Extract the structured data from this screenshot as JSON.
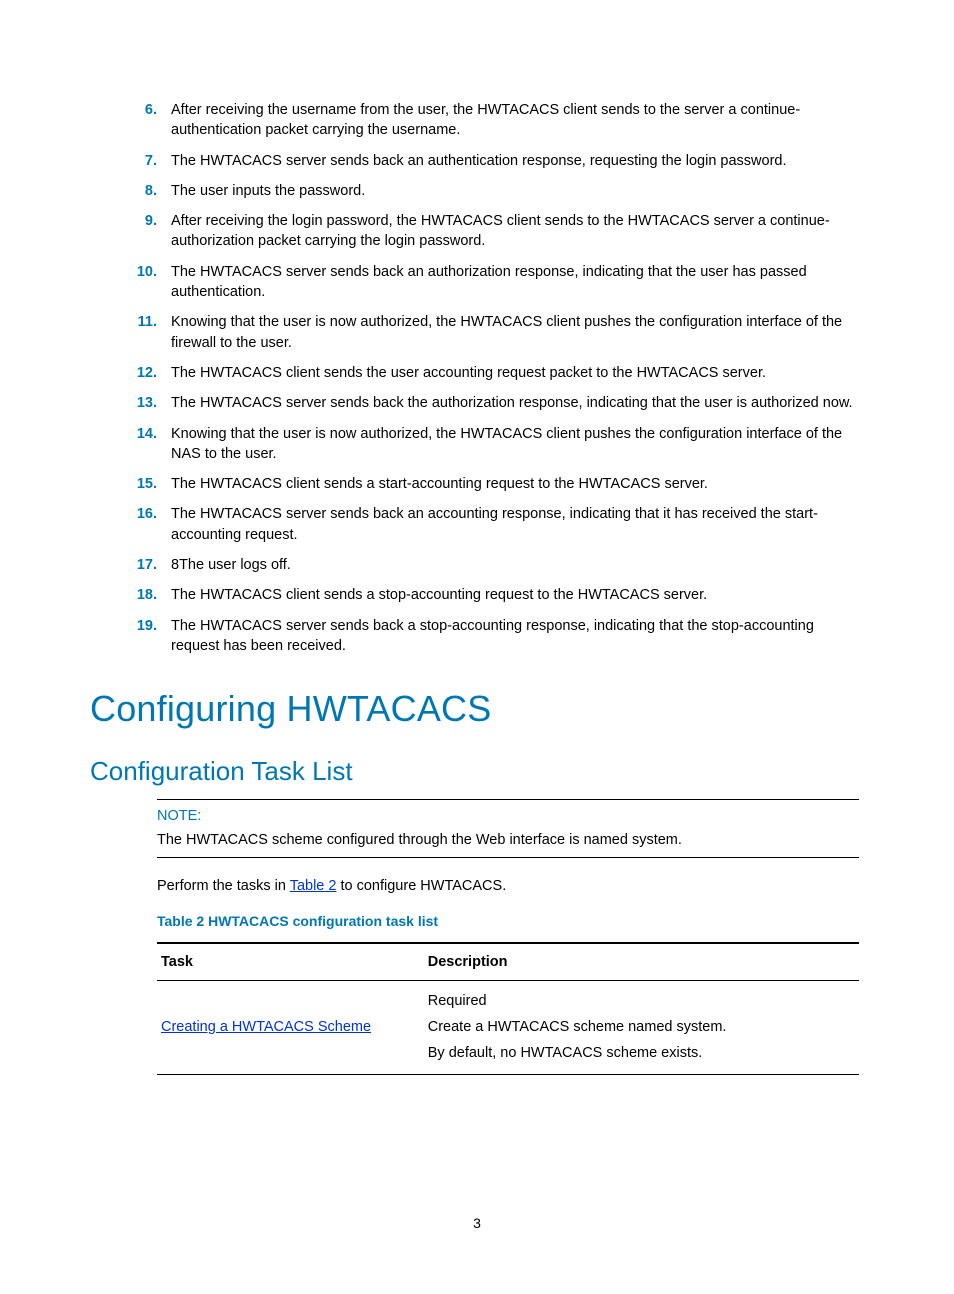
{
  "steps": [
    {
      "n": "6.",
      "t": "After receiving the username from the user, the HWTACACS client sends to the server a continue-authentication packet carrying the username."
    },
    {
      "n": "7.",
      "t": "The HWTACACS server sends back an authentication response, requesting the login password."
    },
    {
      "n": "8.",
      "t": "The user inputs the password."
    },
    {
      "n": "9.",
      "t": "After receiving the login password, the HWTACACS client sends to the HWTACACS server a continue-authorization packet carrying the login password."
    },
    {
      "n": "10.",
      "t": "The HWTACACS server sends back an authorization response, indicating that the user has passed authentication."
    },
    {
      "n": "11.",
      "t": "Knowing that the user is now authorized, the HWTACACS client pushes the configuration interface of the firewall to the user."
    },
    {
      "n": "12.",
      "t": "The HWTACACS client sends the user accounting request packet to the HWTACACS server."
    },
    {
      "n": "13.",
      "t": "The HWTACACS server sends back the authorization response, indicating that the user is authorized now."
    },
    {
      "n": "14.",
      "t": "Knowing that the user is now authorized, the HWTACACS client pushes the configuration interface of the NAS to the user."
    },
    {
      "n": "15.",
      "t": "The HWTACACS client sends a start-accounting request to the HWTACACS server."
    },
    {
      "n": "16.",
      "t": "The HWTACACS server sends back an accounting response, indicating that it has received the start-accounting request."
    },
    {
      "n": "17.",
      "t": "8The user logs off."
    },
    {
      "n": "18.",
      "t": "The HWTACACS client sends a stop-accounting request to the HWTACACS server."
    },
    {
      "n": "19.",
      "t": "The HWTACACS server sends back a stop-accounting response, indicating that the stop-accounting request has been received."
    }
  ],
  "h1": "Configuring HWTACACS",
  "h2": "Configuration Task List",
  "note": {
    "title": "NOTE:",
    "body": "The HWTACACS scheme configured through the Web interface is named system."
  },
  "intro_before": "Perform the tasks in ",
  "intro_link": "Table 2",
  "intro_after": " to configure HWTACACS.",
  "table_caption": "Table 2 HWTACACS configuration task list",
  "table": {
    "headers": {
      "task": "Task",
      "desc": "Description"
    },
    "row1": {
      "task_link": "Creating a HWTACACS Scheme",
      "d1": "Required",
      "d2": "Create a HWTACACS scheme named system.",
      "d3": "By default, no HWTACACS scheme exists."
    }
  },
  "pagenum": "3"
}
